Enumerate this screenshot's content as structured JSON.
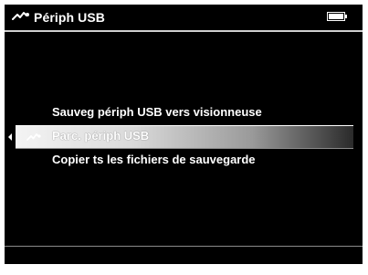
{
  "header": {
    "icon": "usb-device-icon",
    "title": "Périph USB",
    "battery_icon": "battery-full-icon"
  },
  "menu": {
    "items": [
      {
        "label": "Sauveg périph USB vers visionneuse",
        "selected": false
      },
      {
        "label": "Parc. périph USB",
        "selected": true,
        "icon": "usb-device-icon"
      },
      {
        "label": "Copier ts les fichiers de sauvegarde",
        "selected": false
      }
    ]
  },
  "colors": {
    "background": "#000000",
    "text": "#ffffff",
    "highlight_start": "#f4f4f4",
    "highlight_end": "#2a2a2a"
  }
}
